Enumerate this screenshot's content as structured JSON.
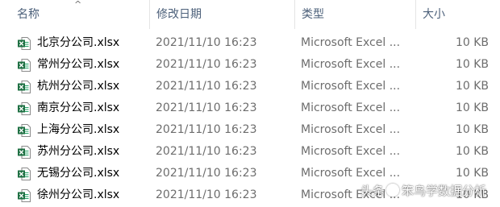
{
  "columns": {
    "name": "名称",
    "modified": "修改日期",
    "type": "类型",
    "size": "大小"
  },
  "files": [
    {
      "name": "北京分公司.xlsx",
      "modified": "2021/11/10 16:23",
      "type": "Microsoft Excel ...",
      "size": "10 KB"
    },
    {
      "name": "常州分公司.xlsx",
      "modified": "2021/11/10 16:23",
      "type": "Microsoft Excel ...",
      "size": "10 KB"
    },
    {
      "name": "杭州分公司.xlsx",
      "modified": "2021/11/10 16:23",
      "type": "Microsoft Excel ...",
      "size": "10 KB"
    },
    {
      "name": "南京分公司.xlsx",
      "modified": "2021/11/10 16:23",
      "type": "Microsoft Excel ...",
      "size": "10 KB"
    },
    {
      "name": "上海分公司.xlsx",
      "modified": "2021/11/10 16:23",
      "type": "Microsoft Excel ...",
      "size": "10 KB"
    },
    {
      "name": "苏州分公司.xlsx",
      "modified": "2021/11/10 16:23",
      "type": "Microsoft Excel ...",
      "size": "10 KB"
    },
    {
      "name": "无锡分公司.xlsx",
      "modified": "2021/11/10 16:23",
      "type": "Microsoft Excel ...",
      "size": "10 KB"
    },
    {
      "name": "徐州分公司.xlsx",
      "modified": "2021/11/10 16:23",
      "type": "Microsoft Excel ...",
      "size": "10 KB"
    }
  ],
  "icons": {
    "file": "excel-file-icon",
    "sort": "sort-ascending-icon"
  },
  "colors": {
    "header_text": "#4c607a",
    "excel_green": "#1d6f42",
    "secondary_text": "#6d6d6d"
  },
  "watermark": {
    "prefix": "头条",
    "author": "笨鸟学数据分析"
  }
}
